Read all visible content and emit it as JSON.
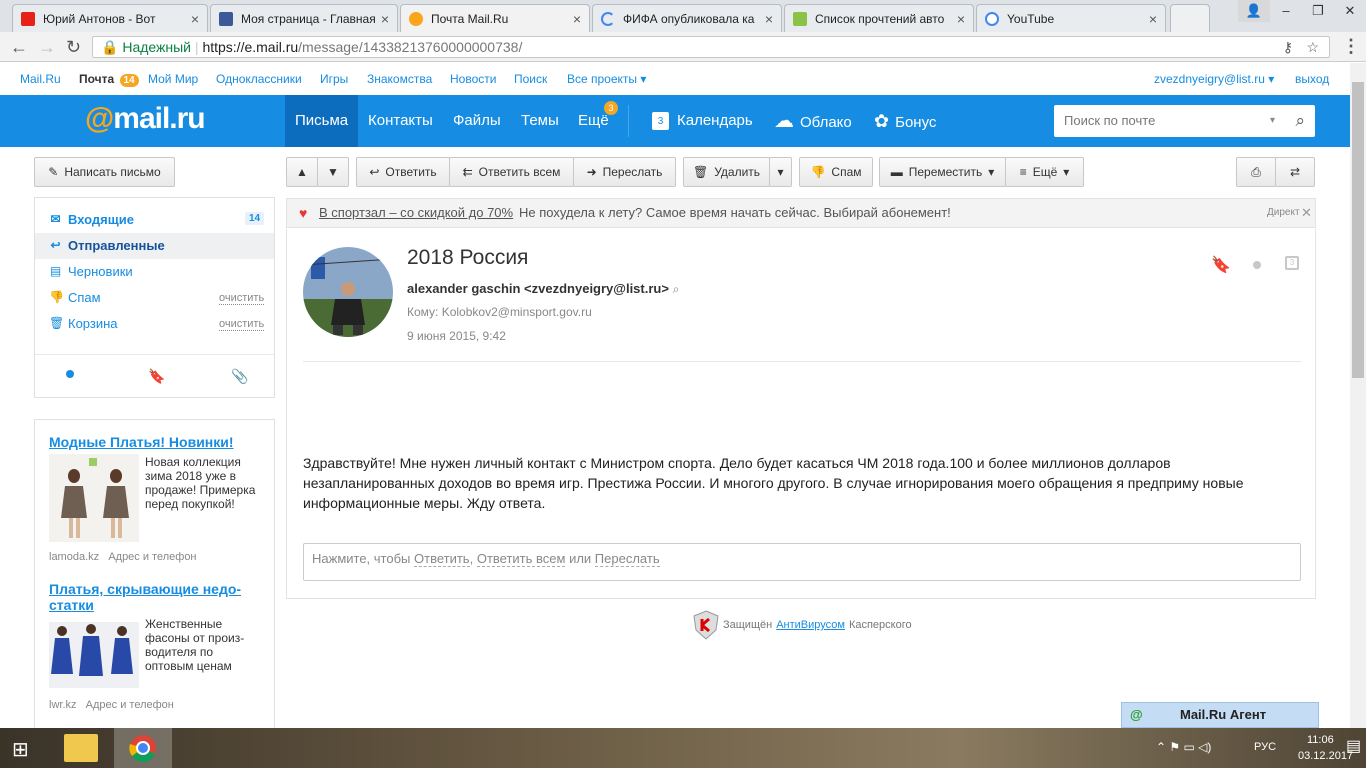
{
  "browser": {
    "tabs": [
      {
        "title": "Юрий Антонов - Вот",
        "icon": "youtube-icon",
        "color": "#e62117"
      },
      {
        "title": "Моя страница - Главная",
        "icon": "facebook-icon",
        "color": "#3b5998"
      },
      {
        "title": "Почта Mail.Ru",
        "icon": "mailru-icon",
        "color": "#168de2"
      },
      {
        "title": "ФИФА опубликовала ка",
        "icon": "loading-icon",
        "color": "#4285f4"
      },
      {
        "title": "Список прочтений авто",
        "icon": "page-icon",
        "color": "#8bc34a"
      },
      {
        "title": "YouTube",
        "icon": "google-icon",
        "color": "#4285f4"
      }
    ],
    "secure_label": "Надежный",
    "url_domain": "https://e.mail.ru",
    "url_path": "/message/14338213760000000738/"
  },
  "portal": {
    "items": [
      "Mail.Ru",
      "Почта",
      "Мой Мир",
      "Одноклассники",
      "Игры",
      "Знакомства",
      "Новости",
      "Поиск",
      "Все проекты"
    ],
    "mail_count": "14",
    "user": "zvezdnyeigry@list.ru",
    "logout": "выход"
  },
  "header": {
    "logo_at": "@",
    "logo_text": "mail.ru",
    "nav": [
      "Письма",
      "Контакты",
      "Файлы",
      "Темы",
      "Ещё"
    ],
    "more_badge": "3",
    "services": [
      "Календарь",
      "Облако",
      "Бонус"
    ],
    "calendar_day": "3",
    "search_placeholder": "Поиск по почте"
  },
  "toolbar": {
    "compose": "Написать письмо",
    "reply": "Ответить",
    "reply_all": "Ответить всем",
    "forward": "Переслать",
    "delete": "Удалить",
    "spam": "Спам",
    "move": "Переместить",
    "more": "Ещё"
  },
  "folders": {
    "inbox": "Входящие",
    "inbox_count": "14",
    "sent": "Отправленные",
    "drafts": "Черновики",
    "spam": "Спам",
    "trash": "Корзина",
    "clean": "очистить"
  },
  "ads": [
    {
      "title": "Модные Платья! Новинки!",
      "text": "Новая коллекция зима 2018 уже в продаже! Примерка перед покупкой!",
      "source": "lamoda.kz",
      "contact": "Адрес и телефон"
    },
    {
      "title": "Платья, скрывающие недо-статки",
      "text": "Женственные фасоны от произ-водителя по оптовым ценам",
      "source": "lwr.kz",
      "contact": "Адрес и телефон"
    }
  ],
  "promo": {
    "link": "В спортзал – со скидкой до 70%",
    "text": "Не похудела к лету? Самое время начать сейчас. Выбирай абонемент!",
    "label": "Директ"
  },
  "message": {
    "subject": "2018 Россия",
    "from": "alexander gaschin <zvezdnyeigry@list.ru>",
    "to": "Кому: Kolobkov2@minsport.gov.ru",
    "date": "9 июня 2015, 9:42",
    "body": " Здравствуйте! Мне нужен личный контакт с Министром спорта. Дело будет касаться ЧМ 2018 года.100 и более миллионов долларов незапланированных доходов во время игр. Престижа России. И многого другого. В случае игнорирования моего обращения я предприму новые информационные меры. Жду ответа.",
    "reply_prefix": "Нажмите, чтобы",
    "reply_link": "Ответить",
    "reply_all_link": "Ответить всем",
    "reply_or": "или",
    "forward_link": "Переслать"
  },
  "kaspersky": {
    "prefix": "Защищён",
    "link": "АнтиВирусом",
    "suffix": "Касперского"
  },
  "agent": "Mail.Ru Агент",
  "taskbar": {
    "lang": "РУС",
    "time": "11:06",
    "date": "03.12.2017"
  }
}
